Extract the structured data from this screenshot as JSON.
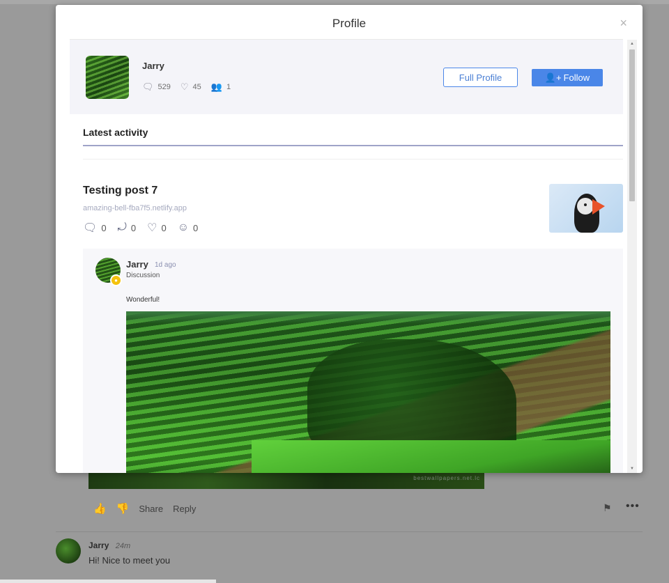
{
  "modal": {
    "title": "Profile",
    "close_symbol": "×"
  },
  "profile": {
    "name": "Jarry",
    "stats": {
      "comments": "529",
      "likes": "45",
      "followers": "1"
    },
    "full_profile_label": "Full Profile",
    "follow_label": "Follow"
  },
  "activity": {
    "section_title": "Latest activity",
    "post": {
      "title": "Testing post 7",
      "link": "amazing-bell-fba7f5.netlify.app",
      "counts": {
        "comments": "0",
        "shares": "0",
        "likes": "0",
        "reactions": "0"
      }
    },
    "comment": {
      "author": "Jarry",
      "time": "1d ago",
      "category": "Discussion",
      "text": "Wonderful!"
    }
  },
  "background": {
    "watermark": "bestwallpapers.net.lc",
    "share_label": "Share",
    "reply_label": "Reply",
    "reply_author": "Jarry",
    "reply_time": "24m",
    "reply_text": "Hi! Nice to meet you"
  },
  "icons": {
    "close": "close-icon",
    "comment": "comment-icon",
    "heart": "heart-icon",
    "users": "users-icon",
    "share": "share-icon",
    "smile": "smile-icon",
    "add_user": "add-user-icon",
    "thumbs_up": "thumbs-up-icon",
    "thumbs_down": "thumbs-down-icon",
    "flag": "flag-icon",
    "more": "more-icon"
  },
  "colors": {
    "accent": "#4a86e8",
    "badge": "#f4c20d",
    "card_bg": "#f4f4f9"
  }
}
